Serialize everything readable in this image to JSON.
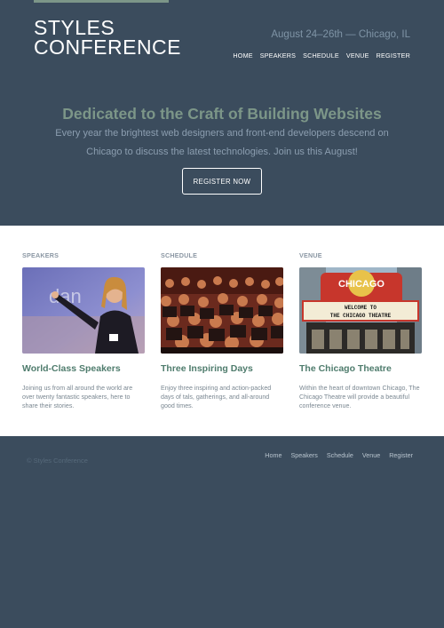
{
  "brand": {
    "line1": "Styles",
    "line2": "Conference"
  },
  "header": {
    "tagline": "August 24–26th — Chicago, IL",
    "nav": [
      "Home",
      "Speakers",
      "Schedule",
      "Venue",
      "Register"
    ]
  },
  "hero": {
    "title": "Dedicated to the Craft of Building Websites",
    "lead": "Every year the brightest web designers and front-end developers descend on Chicago to discuss the latest technologies. Join us this August!",
    "button": "Register Now"
  },
  "columns": [
    {
      "title": "Speakers",
      "heading": "World-Class Speakers",
      "text": "Joining us from all around the world are over twenty fantastic speakers, here to share their stories.",
      "image_icon": "speaker-photo"
    },
    {
      "title": "Schedule",
      "heading": "Three Inspiring Days",
      "text": "Enjoy three inspiring and action-packed days of tals, gatherings, and all-around good times.",
      "image_icon": "audience-photo"
    },
    {
      "title": "Venue",
      "heading": "The Chicago Theatre",
      "text": "Within the heart of downtown Chicago, The Chicago Theatre will provide a beautiful conference venue.",
      "image_icon": "theatre-photo",
      "marquee_sign": "CHICAGO",
      "marquee_line1": "WELCOME TO",
      "marquee_line2": "THE CHICAGO THEATRE"
    }
  ],
  "footer": {
    "copyright": "© Styles Conference",
    "nav": [
      "Home",
      "Speakers",
      "Schedule",
      "Venue",
      "Register"
    ]
  },
  "colors": {
    "background": "#3b4c5d",
    "accent_green": "#7c9688",
    "heading_green": "#4f7c6d",
    "white": "#ffffff"
  }
}
